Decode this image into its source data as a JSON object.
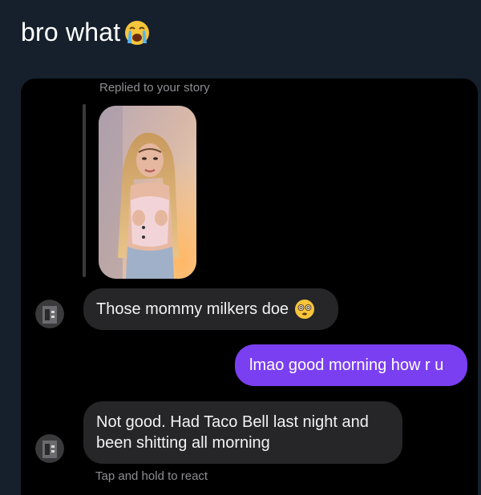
{
  "post": {
    "title": "bro what",
    "title_emoji": "loudly-crying-face-emoji"
  },
  "chat": {
    "reply_label": "Replied to your story",
    "story_thumbnail": "story-photo",
    "messages": [
      {
        "sender": "them",
        "text": "Those mommy milkers doe",
        "emoji": "dizzy-face-emoji"
      },
      {
        "sender": "me",
        "text": "lmao good morning how r u"
      },
      {
        "sender": "them",
        "line1": "Not good. Had Taco Bell last night and",
        "line2": "been shitting all morning"
      }
    ],
    "reaction_hint": "Tap and hold to react"
  },
  "colors": {
    "page_background": "#16202c",
    "chat_background": "#000000",
    "received_bubble": "#262629",
    "sent_bubble": "#7b3ff2",
    "secondary_text": "#8e8e93"
  }
}
